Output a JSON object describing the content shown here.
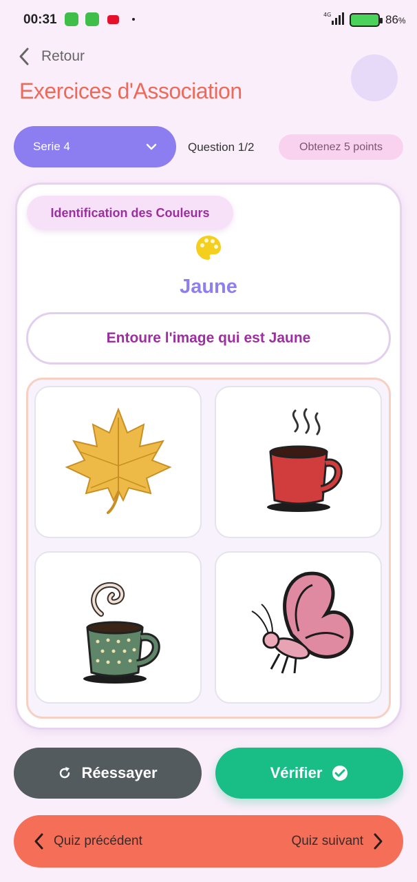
{
  "status_bar": {
    "time": "00:31",
    "network": "4G",
    "battery_pct": "86",
    "battery_unit": "%"
  },
  "header": {
    "back_label": "Retour",
    "title": "Exercices d'Association"
  },
  "controls": {
    "series_label": "Serie 4",
    "question_label": "Question 1/2",
    "points_label": "Obtenez 5 points"
  },
  "exercise": {
    "topic": "Identification des Couleurs",
    "color_name": "Jaune",
    "instruction": "Entoure l'image qui est Jaune",
    "images": [
      "maple-leaf",
      "red-cup",
      "green-cup",
      "butterfly"
    ]
  },
  "actions": {
    "retry_label": "Réessayer",
    "verify_label": "Vérifier"
  },
  "navigation": {
    "prev_label": "Quiz précédent",
    "next_label": "Quiz suivant"
  },
  "colors": {
    "accent": "#8c7df0",
    "title": "#ee6a58",
    "verify": "#19be86",
    "retry": "#545b5e",
    "nav": "#f56f58"
  }
}
